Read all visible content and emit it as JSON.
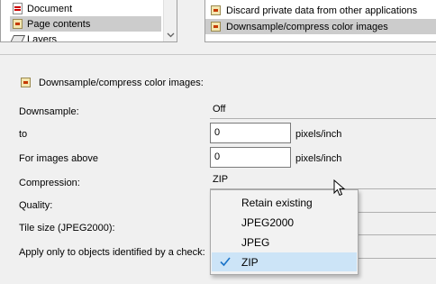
{
  "left_tree": {
    "items": [
      {
        "label": "Document",
        "icon": "document-icon"
      },
      {
        "label": "Page contents",
        "icon": "page-contents-icon"
      },
      {
        "label": "Layers",
        "icon": "layers-icon"
      }
    ]
  },
  "right_list": {
    "items": [
      {
        "label": "Discard private data from other applications"
      },
      {
        "label": "Downsample/compress color images"
      }
    ]
  },
  "section": {
    "title": "Downsample/compress color images:"
  },
  "form": {
    "downsample": {
      "label": "Downsample:",
      "value": "Off"
    },
    "to": {
      "label": "to",
      "value": "0",
      "unit": "pixels/inch"
    },
    "above": {
      "label": "For images above",
      "value": "0",
      "unit": "pixels/inch"
    },
    "compression": {
      "label": "Compression:",
      "value": "ZIP"
    },
    "quality": {
      "label": "Quality:"
    },
    "tile_size": {
      "label": "Tile size (JPEG2000):"
    },
    "apply_only": {
      "label": "Apply only to objects identified by a check:"
    }
  },
  "dropdown": {
    "options": [
      "Retain existing",
      "JPEG2000",
      "JPEG",
      "ZIP"
    ],
    "selected": "ZIP"
  },
  "colors": {
    "selection": "#cce4f7",
    "check": "#1a73c8"
  }
}
